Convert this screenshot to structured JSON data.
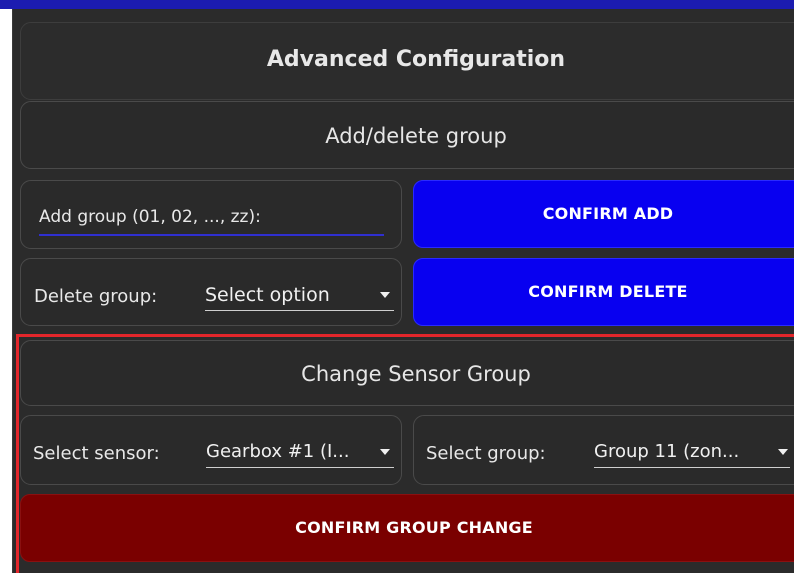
{
  "header": {
    "title": "Advanced Configuration"
  },
  "group_section": {
    "title": "Add/delete group",
    "add_label": "Add group (01, 02, ..., zz):",
    "add_value": "",
    "confirm_add": "CONFIRM ADD",
    "delete_label": "Delete group:",
    "delete_selected": "Select option",
    "confirm_delete": "CONFIRM DELETE"
  },
  "sensor_section": {
    "title": "Change Sensor Group",
    "sensor_label": "Select sensor:",
    "sensor_selected": "Gearbox #1 (I...",
    "group_label": "Select group:",
    "group_selected": "Group 11 (zon...",
    "confirm_change": "CONFIRM GROUP CHANGE"
  },
  "colors": {
    "primary_button": "#0800f0",
    "danger_button": "#7a0000",
    "highlight_border": "#e3262b",
    "panel_background": "#2b2b2b"
  },
  "icons": {
    "dropdown": "chevron-down-icon"
  }
}
